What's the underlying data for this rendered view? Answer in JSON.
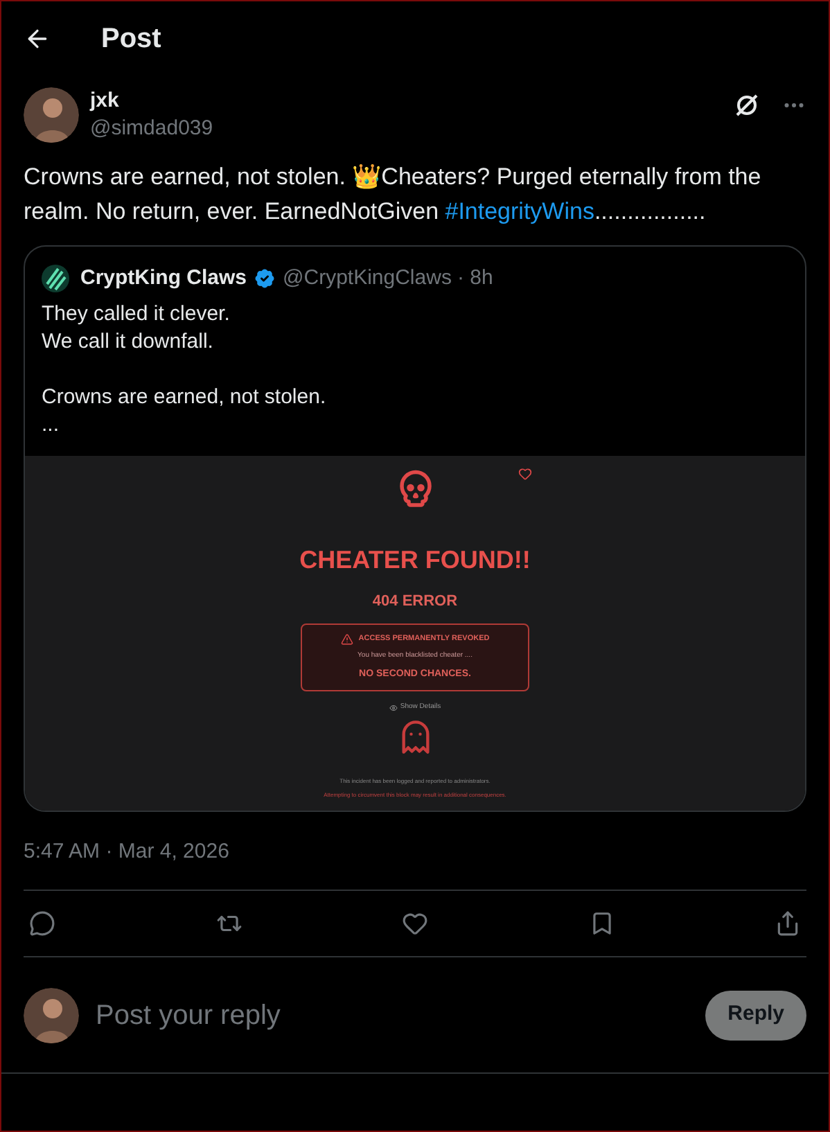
{
  "header": {
    "title": "Post"
  },
  "author": {
    "name": "jxk",
    "handle": "@simdad039"
  },
  "post": {
    "text": "Crowns are earned, not stolen. 👑Cheaters? Purged eternally from the realm. No return, ever. EarnedNotGiven ",
    "hashtag": "#IntegrityWins",
    "trailing": "................."
  },
  "quote": {
    "name": "CryptKing Claws",
    "verified": true,
    "handle": "@CryptKingClaws",
    "time": "· 8h",
    "paragraphs": [
      [
        "They called it clever.",
        "We call it downfall."
      ],
      [
        "Crowns are earned, not stolen.",
        "..."
      ]
    ],
    "screenshot": {
      "title": "CHEATER FOUND!!",
      "code": "404 ERROR",
      "alert_title": "ACCESS PERMANENTLY REVOKED",
      "alert_text": "You have been blacklisted cheater ....",
      "alert_emphasis": "NO SECOND CHANCES.",
      "details_link": "Show Details",
      "footer_lines": [
        "This incident has been logged and reported to administrators.",
        "Attempting to circumvent this block may result in additional consequences."
      ]
    }
  },
  "timestamp": "5:47 AM · Mar 4, 2026",
  "actions": [
    {
      "kind": "reply"
    },
    {
      "kind": "repost"
    },
    {
      "kind": "like"
    },
    {
      "kind": "bookmark"
    },
    {
      "kind": "share"
    }
  ],
  "reply_box": {
    "placeholder": "Post your reply",
    "button": "Reply",
    "disabled": true
  }
}
